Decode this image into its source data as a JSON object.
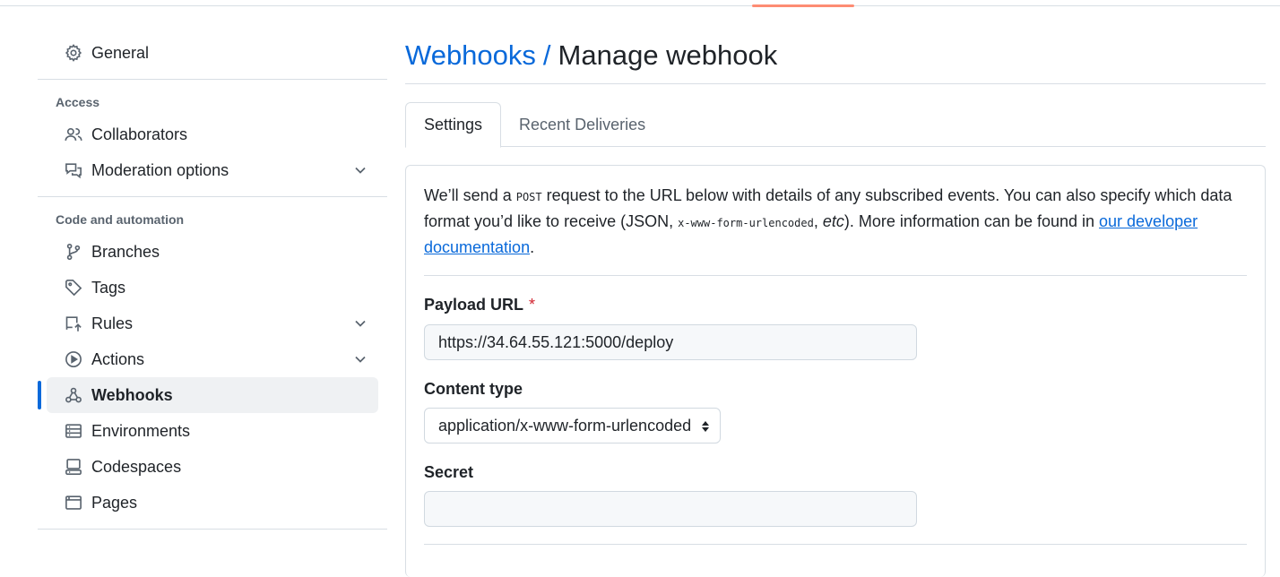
{
  "sidebar": {
    "general": "General",
    "access_heading": "Access",
    "collaborators": "Collaborators",
    "moderation": "Moderation options",
    "code_heading": "Code and automation",
    "branches": "Branches",
    "tags": "Tags",
    "rules": "Rules",
    "actions": "Actions",
    "webhooks": "Webhooks",
    "environments": "Environments",
    "codespaces": "Codespaces",
    "pages": "Pages"
  },
  "header": {
    "crumb": "Webhooks",
    "slash": "/",
    "title": "Manage webhook"
  },
  "tabs": [
    "Settings",
    "Recent Deliveries"
  ],
  "intro": {
    "p1": "We’ll send a ",
    "post": "POST",
    "p2": " request to the URL below with details of any subscribed events. You can also specify which data format you’d like to receive (JSON, ",
    "code": "x-www-form-urlencoded",
    "p3": ", ",
    "etc": "etc",
    "p4": "). More information can be found in ",
    "link": "our developer documentation",
    "p5": "."
  },
  "form": {
    "payload_label": "Payload URL",
    "required_mark": "*",
    "payload_value": "https://34.64.55.121:5000/deploy",
    "content_type_label": "Content type",
    "content_type_value": "application/x-www-form-urlencoded",
    "secret_label": "Secret",
    "secret_value": ""
  },
  "colors": {
    "accent": "#0969da",
    "required": "#d1242f",
    "tab_underline": "#fd8c73"
  }
}
